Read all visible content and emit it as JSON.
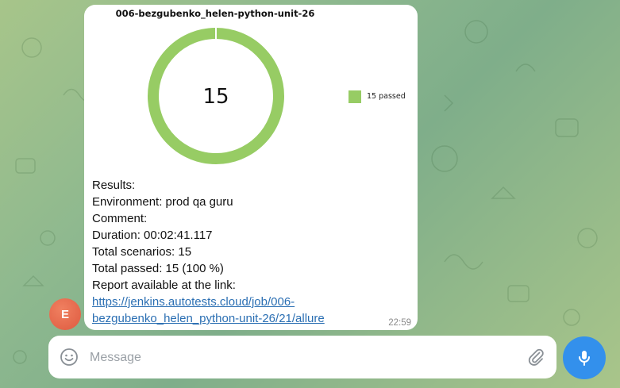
{
  "message": {
    "title": "006-bezgubenko_helen-python-unit-26",
    "chart_data": {
      "type": "pie",
      "variant": "donut",
      "center_label": "15",
      "slices": [
        {
          "label": "15 passed",
          "value": 15,
          "color": "#97cc64"
        }
      ],
      "legend": [
        "15 passed"
      ],
      "legend_position": "right"
    },
    "results_label": "Results:",
    "environment_label": "Environment:",
    "environment_value": " prod qa guru",
    "comment_label": "Comment:",
    "duration_label": "Duration:",
    "duration_value": " 00:02:41.117",
    "total_scenarios_label": "Total scenarios:",
    "total_scenarios_value": " 15",
    "total_passed_label": "Total passed:",
    "total_passed_value": " 15 (100 %)",
    "report_label": "Report available at the link:",
    "report_link_line1": "https://jenkins.autotests.cloud/job/006-",
    "report_link_line2": "bezgubenko_helen_python-unit-26/21/allure",
    "time": "22:59"
  },
  "sender": {
    "avatar_letter": "E",
    "avatar_color": "#e0603f"
  },
  "composer": {
    "placeholder": "Message"
  },
  "colors": {
    "accent": "#3390ec",
    "passed": "#97cc64",
    "link": "#2b6fb3"
  },
  "icons": {
    "emoji": "smile-icon",
    "attach": "paperclip-icon",
    "mic": "microphone-icon"
  }
}
